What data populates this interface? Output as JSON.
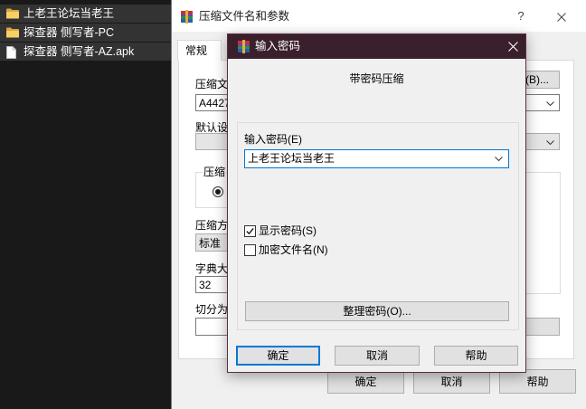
{
  "colors": {
    "explorer_bg": "#191919",
    "explorer_row": "#333333",
    "dialog_bg": "#f0f0f0",
    "button_bg": "#e1e1e1",
    "accent": "#0078d7",
    "modal_titlebar": "#3a1f2c",
    "modal_border": "#5b2d41"
  },
  "explorer": {
    "items": [
      {
        "name": "上老王论坛当老王",
        "icon": "folder-icon"
      },
      {
        "name": "探查器 侧写者-PC",
        "icon": "folder-icon"
      },
      {
        "name": "探查器 侧写者-AZ.apk",
        "icon": "file-icon"
      }
    ]
  },
  "archive_dialog": {
    "title": "压缩文件名和参数",
    "help_label": "?",
    "icon": "winrar-icon",
    "tabs": [
      {
        "label": "常规"
      }
    ],
    "general": {
      "archive_name_label": "压缩文",
      "archive_name_value": "A4427",
      "browse_button": "(B)...",
      "profile_label": "默认设",
      "format_group_label": "压缩",
      "method_label": "压缩方",
      "method_value": "标准",
      "dictionary_label": "字典大",
      "dictionary_value": "32",
      "split_label": "切分为"
    },
    "buttons": {
      "ok": "确定",
      "cancel": "取消",
      "help": "帮助"
    }
  },
  "password_dialog": {
    "title": "输入密码",
    "icon": "winrar-icon",
    "heading": "带密码压缩",
    "password_label": "输入密码(E)",
    "password_value": "上老王论坛当老王",
    "show_password": {
      "label": "显示密码(S)",
      "checked": true
    },
    "encrypt_filenames": {
      "label": "加密文件名(N)",
      "checked": false
    },
    "organize_button": "整理密码(O)...",
    "buttons": {
      "ok": "确定",
      "cancel": "取消",
      "help": "帮助"
    }
  }
}
